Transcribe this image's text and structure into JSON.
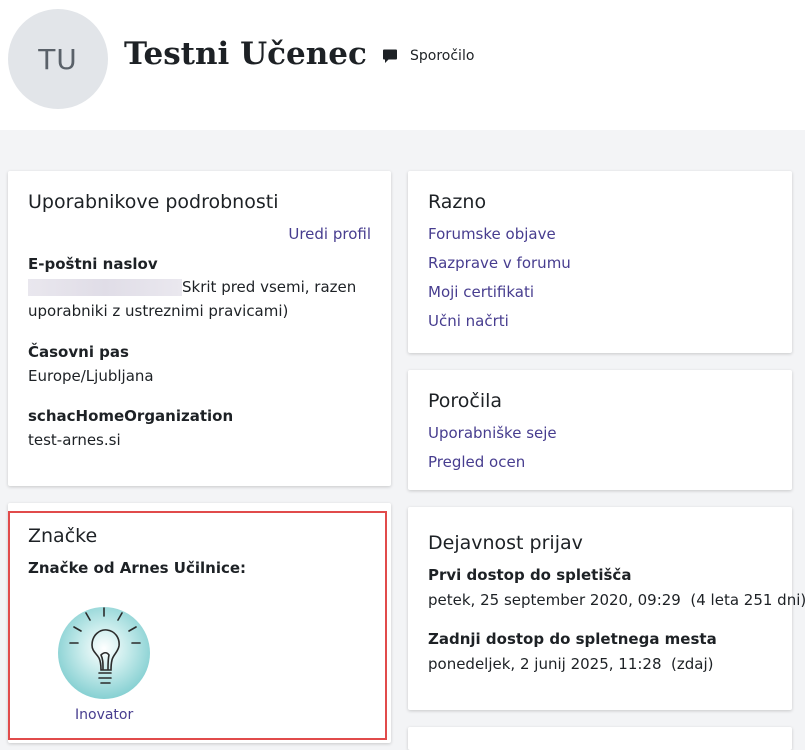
{
  "profile": {
    "initials": "TU",
    "name": "Testni Učenec",
    "message_label": "Sporočilo"
  },
  "details": {
    "title": "Uporabnikove podrobnosti",
    "edit_link": "Uredi profil",
    "email_label": "E-poštni naslov",
    "email_hidden_note": "Skrit pred vsemi, razen uporabniki z ustreznimi pravicami)",
    "timezone_label": "Časovni pas",
    "timezone_value": "Europe/Ljubljana",
    "org_label": "schacHomeOrganization",
    "org_value": "test-arnes.si"
  },
  "misc": {
    "title": "Razno",
    "links": [
      "Forumske objave",
      "Razprave v forumu",
      "Moji certifikati",
      "Učni načrti"
    ]
  },
  "reports": {
    "title": "Poročila",
    "links": [
      "Uporabniške seje",
      "Pregled ocen"
    ]
  },
  "badges": {
    "title": "Značke",
    "subtitle": "Značke od Arnes Učilnice:",
    "items": [
      {
        "name": "Inovator",
        "icon": "lightbulb-badge-icon"
      }
    ]
  },
  "login_activity": {
    "title": "Dejavnost prijav",
    "first_access_label": "Prvi dostop do spletišča",
    "first_access_value": "petek, 25 september 2020, 09:29  (4 leta 251 dni)",
    "last_access_label": "Zadnji dostop do spletnega mesta",
    "last_access_value": "ponedeljek, 2 junij 2025, 11:28  (zdaj)"
  },
  "colors": {
    "link": "#473d8f",
    "highlight": "#e14b4b",
    "avatar_bg": "#e2e5e9"
  }
}
